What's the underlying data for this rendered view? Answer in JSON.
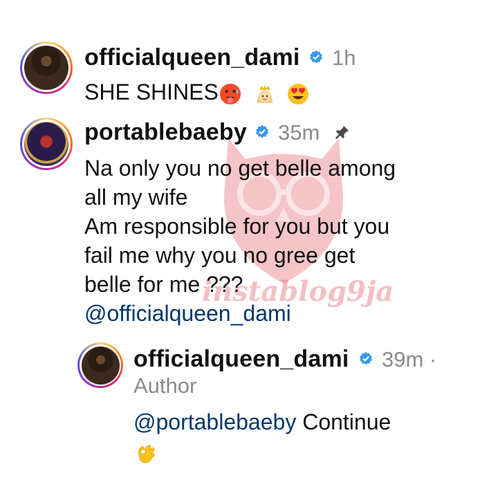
{
  "comments": [
    {
      "username": "officialqueen_dami",
      "time": "1h",
      "text": "SHE SHINES",
      "emoji_names": [
        "hot-face-emoji",
        "princess-emoji",
        "heart-eyes-emoji"
      ]
    },
    {
      "username": "portablebaeby",
      "time": "35m",
      "pinned": true,
      "lines": [
        "Na only you no get belle among",
        "all my wife",
        "Am responsible for you but you",
        "fail me why you no gree get",
        "belle for me ???"
      ],
      "mention": "@officialqueen_dami"
    }
  ],
  "reply": {
    "username": "officialqueen_dami",
    "time": "39m ·",
    "author_label": "Author",
    "mention": "@portablebaeby",
    "text": " Continue",
    "emoji_name": "ok-hand-emoji"
  },
  "watermark": {
    "text": "instablog9ja",
    "color": "#e8737a"
  },
  "colors": {
    "verified": "#3897f0",
    "mention": "#00376b",
    "meta": "#8a8a8a"
  }
}
